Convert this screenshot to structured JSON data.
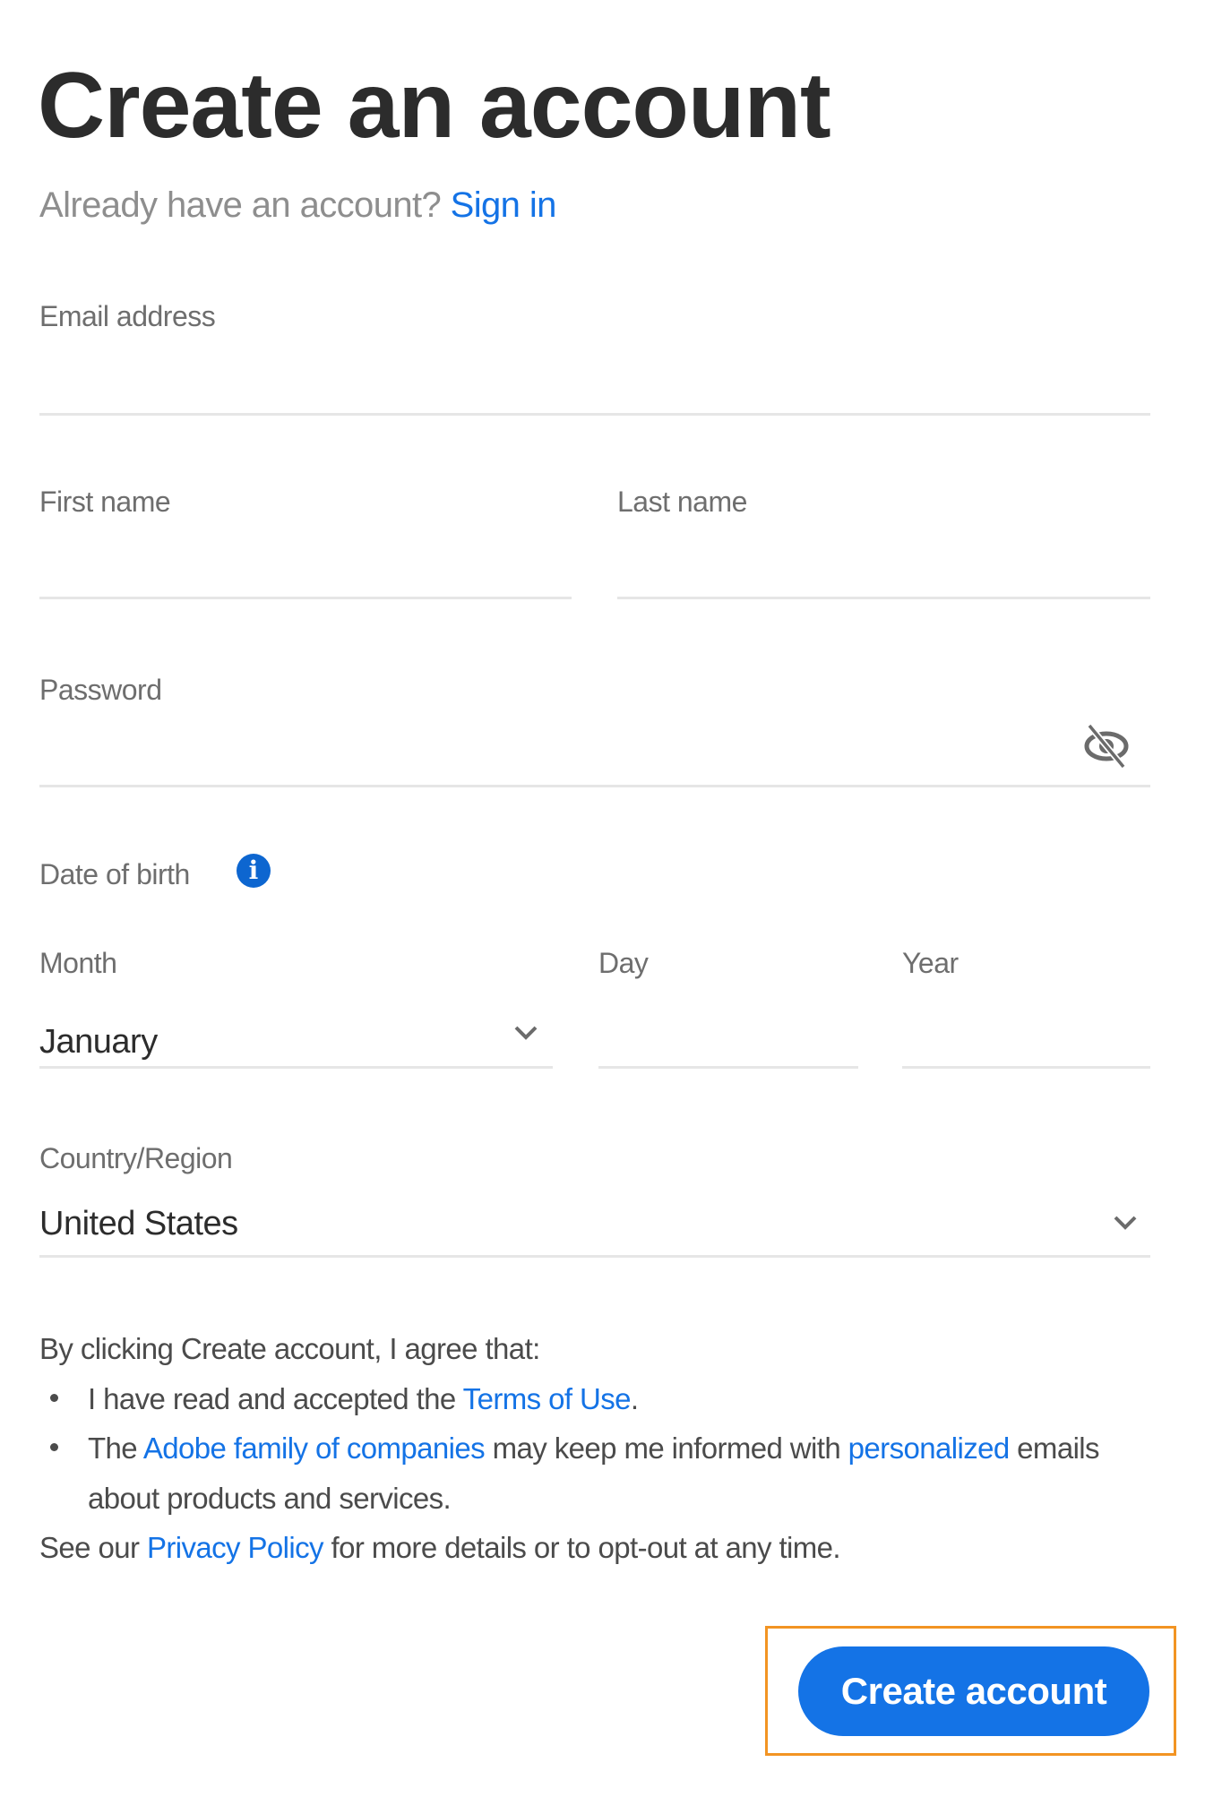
{
  "header": {
    "title": "Create an account",
    "subtitle_prefix": "Already have an account?",
    "sign_in_link": "Sign in"
  },
  "form": {
    "email": {
      "label": "Email address",
      "value": ""
    },
    "first_name": {
      "label": "First name",
      "value": ""
    },
    "last_name": {
      "label": "Last name",
      "value": ""
    },
    "password": {
      "label": "Password",
      "value": "",
      "toggle_icon": "eye-slash-icon"
    },
    "date_of_birth": {
      "label": "Date of birth",
      "info_icon": "info-icon",
      "info_glyph": "i",
      "month": {
        "label": "Month",
        "selected": "January"
      },
      "day": {
        "label": "Day",
        "value": ""
      },
      "year": {
        "label": "Year",
        "value": ""
      }
    },
    "country": {
      "label": "Country/Region",
      "selected": "United States"
    }
  },
  "consent": {
    "intro": "By clicking Create account, I agree that:",
    "bullet1_text": "I have read and accepted the ",
    "bullet1_link": "Terms of Use",
    "bullet1_end": ".",
    "bullet2_pre": "The ",
    "bullet2_link1": "Adobe family of companies",
    "bullet2_mid": " may keep me informed with ",
    "bullet2_link2": "personalized",
    "bullet2_end": " emails about products and services.",
    "footer_pre": "See our ",
    "footer_link": "Privacy Policy",
    "footer_end": " for more details or to opt-out at any time."
  },
  "actions": {
    "create_account_label": "Create account"
  },
  "colors": {
    "accent": "#1473e6",
    "info_icon": "#0d66d0",
    "focus_ring": "#f29423",
    "heading": "#2c2c2c",
    "label": "#6e6e6e"
  }
}
